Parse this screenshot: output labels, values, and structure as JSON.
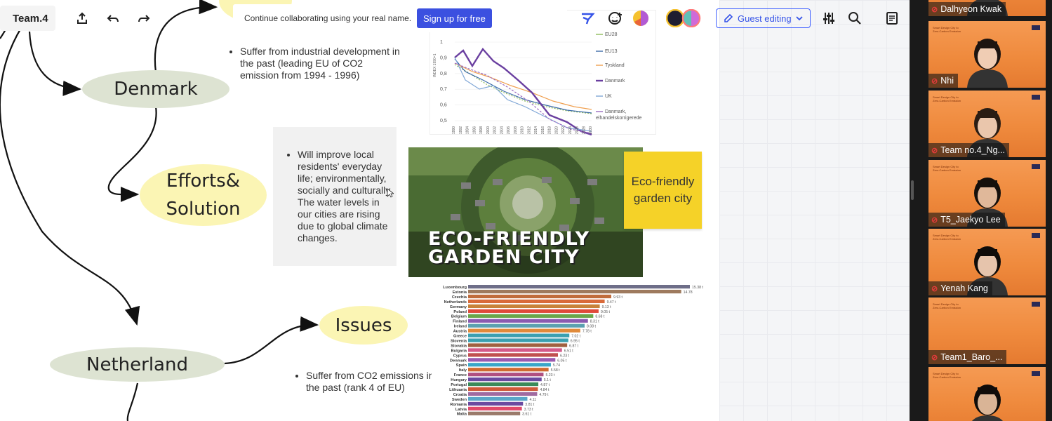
{
  "toolbar": {
    "board_title": "Team.4",
    "banner_text": "Continue collaborating using your real name.",
    "signup_label": "Sign up for free",
    "guest_label": "Guest editing"
  },
  "mindmap": {
    "denmark": "Denmark",
    "efforts_line1": "Efforts&",
    "efforts_line2": "Solution",
    "issues": "Issues",
    "netherland": "Netherland"
  },
  "notes": {
    "denmark_issue": "Suffer from industrial development in the past (leading EU of CO2 emission from 1994 - 1996)",
    "efforts_card": "Will improve local residents' everyday life; environmentally, socially and culturally. The water levels in our cities are rising due to global climate changes.",
    "netherland_issue": "Suffer from CO2 emissions in the past (rank 4 of EU)",
    "sticky": "Eco-friendly garden city"
  },
  "image": {
    "caption_line1": "ECO-FRIENDLY",
    "caption_line2": "GARDEN CITY"
  },
  "line_chart": {
    "y_axis_label": "INDEX 1990=1",
    "y_ticks": [
      "1",
      "0,9",
      "0,8",
      "0,7",
      "0,6",
      "0,5"
    ],
    "x_ticks": [
      "1990",
      "1992",
      "1994",
      "1996",
      "1998",
      "2000",
      "2002",
      "2004",
      "2006",
      "2008",
      "2010",
      "2012",
      "2014",
      "2016",
      "2018",
      "2020",
      "2022",
      "2024",
      "2026",
      "2028",
      "2030"
    ],
    "legend": [
      "EU28",
      "EU13",
      "Tyskland",
      "Danmark",
      "UK",
      "Danmark, elhandelskorrigerede"
    ],
    "colors": [
      "#8fbc5a",
      "#3d6ba8",
      "#f0a050",
      "#6a3fa0",
      "#7fa6d6",
      "#9a6ac0"
    ]
  },
  "bar_chart": {
    "countries": [
      "Luxembourg",
      "Estonia",
      "Czechia",
      "Netherlands",
      "Germany",
      "Poland",
      "Belgium",
      "Finland",
      "Ireland",
      "Austria",
      "Greece",
      "Slovenia",
      "Slovakia",
      "Bulgaria",
      "Cyprus",
      "Denmark",
      "Spain",
      "Italy",
      "France",
      "Hungary",
      "Portugal",
      "Lithuania",
      "Croatia",
      "Sweden",
      "Romania",
      "Latvia",
      "Malta"
    ],
    "values": [
      "15.38 t",
      "14.78",
      "9.93 t",
      "9.47 t",
      "9.13 t",
      "9.05 t",
      "8.68 t",
      "8.31 t",
      "8.08 t",
      "7.78 t",
      "7.02 t",
      "6.95 t",
      "6.87 t",
      "6.51 t",
      "6.23 t",
      "6.05 t",
      "5.74",
      "5.58 t",
      "5.23 t",
      "5.1 t",
      "4.87 t",
      "4.84 t",
      "4.79 t",
      "4.11",
      "3.81 t",
      "3.73 t",
      "3.61 t"
    ],
    "colors": [
      "#6e6e88",
      "#9e7a5e",
      "#c06c3c",
      "#d96a3a",
      "#c8823a",
      "#e04a3a",
      "#6aa64a",
      "#8a5ab0",
      "#5aa0b0",
      "#e08a3a",
      "#3aa0b0",
      "#3aa0b0",
      "#a06040",
      "#d45a8a",
      "#c05050",
      "#9a5ab0",
      "#3aa6c8",
      "#d06a30",
      "#b05080",
      "#6a4aa0",
      "#3a8a5a",
      "#d05a3a",
      "#a06aa0",
      "#5aa6c8",
      "#6a4aa0",
      "#e04a6a",
      "#9a7a6a"
    ]
  },
  "participants": [
    {
      "name": "Dalhyeon Kwak"
    },
    {
      "name": "Nhi"
    },
    {
      "name": "Team no.4_Ng..."
    },
    {
      "name": "T5_Jaekyo Lee"
    },
    {
      "name": "Yenah Kang"
    },
    {
      "name": "Team1_Baro_..."
    },
    {
      "name": ""
    }
  ],
  "slide_text": "Smart Design City to Zero-Carbon Emission"
}
